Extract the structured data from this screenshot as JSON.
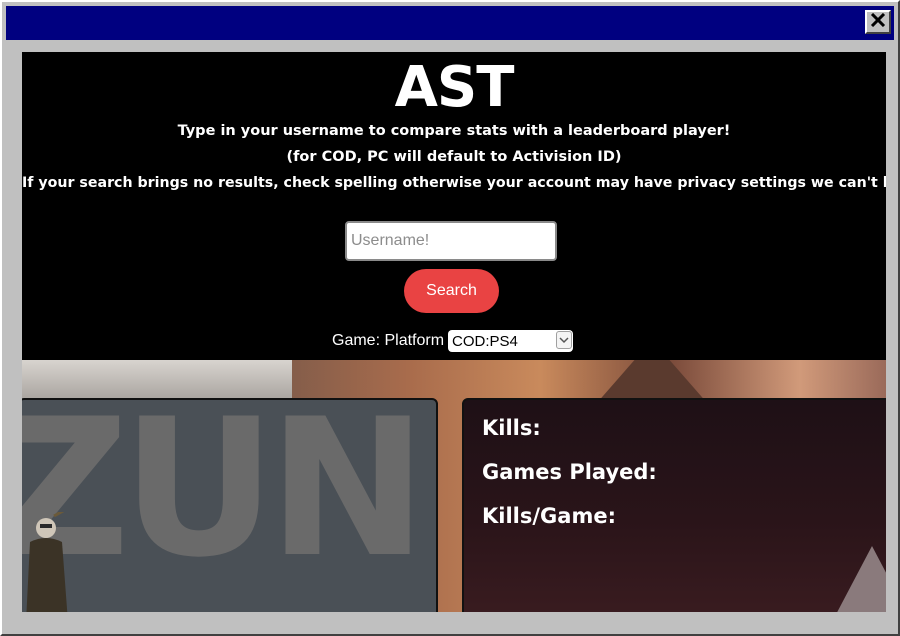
{
  "window": {
    "close_icon": "close-icon",
    "colors": {
      "titlebar": "#000080",
      "chrome": "#c0c0c0"
    }
  },
  "header": {
    "title": "AST",
    "line1": "Type in your username to compare stats with a leaderboard player!",
    "line2": "(for COD, PC will default to Activision ID)",
    "line3": "If your search brings no results, check spelling otherwise your account may have privacy settings we can't bypass."
  },
  "search": {
    "placeholder": "Username!",
    "value": "",
    "button_label": "Search",
    "button_color": "#e94343"
  },
  "platform": {
    "label": "Game: Platform",
    "selected": "COD:PS4"
  },
  "stats": {
    "kills_label": "Kills:",
    "games_played_label": "Games Played:",
    "kills_per_game_label": "Kills/Game:"
  },
  "banner": {
    "text": "ZUN"
  }
}
